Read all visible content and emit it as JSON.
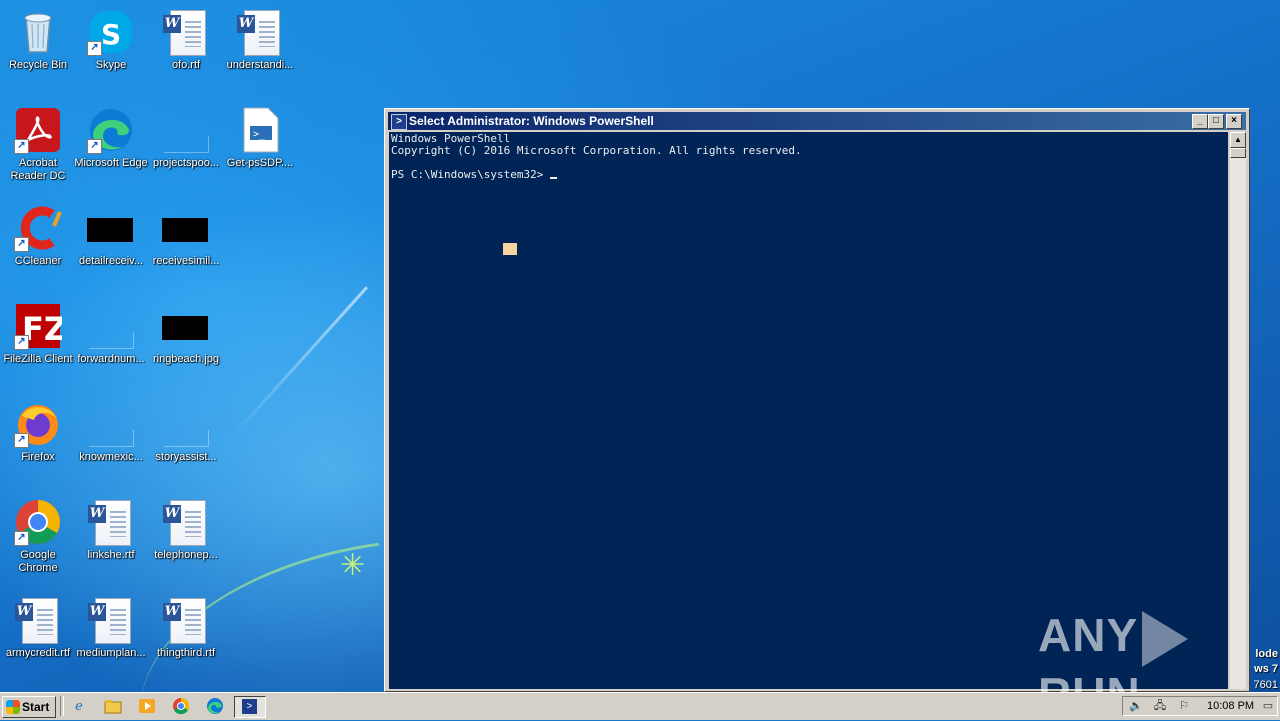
{
  "desktop": {
    "icons": [
      {
        "label": "Recycle Bin"
      },
      {
        "label": "Skype"
      },
      {
        "label": "ofo.rtf"
      },
      {
        "label": "understandi..."
      },
      {
        "label": "Acrobat Reader DC"
      },
      {
        "label": "Microsoft Edge"
      },
      {
        "label": "projectspoo..."
      },
      {
        "label": "Get-psSDP...."
      },
      {
        "label": "CCleaner"
      },
      {
        "label": "detailreceiv..."
      },
      {
        "label": "receivesimil..."
      },
      {
        "label": "FileZilla Client"
      },
      {
        "label": "forwardnum..."
      },
      {
        "label": "ringbeach.jpg"
      },
      {
        "label": "Firefox"
      },
      {
        "label": "knowmexic..."
      },
      {
        "label": "storyassist..."
      },
      {
        "label": "Google Chrome"
      },
      {
        "label": "linkshe.rtf"
      },
      {
        "label": "telephonep..."
      },
      {
        "label": "armycredit.rtf"
      },
      {
        "label": "mediumplan..."
      },
      {
        "label": "thingthird.rtf"
      }
    ]
  },
  "powershell": {
    "title": "Select Administrator: Windows PowerShell",
    "lines": [
      "Windows PowerShell",
      "Copyright (C) 2016 Microsoft Corporation. All rights reserved.",
      "",
      "PS C:\\Windows\\system32> "
    ],
    "colors": {
      "background": "#012456",
      "foreground": "#eeedf0"
    }
  },
  "watermark": {
    "text_left": "ANY",
    "text_right": "RUN"
  },
  "edge_text": {
    "line1": "lode",
    "line2": "ws 7",
    "line3": "7601"
  },
  "taskbar": {
    "start_label": "Start",
    "clock": "10:08 PM"
  }
}
